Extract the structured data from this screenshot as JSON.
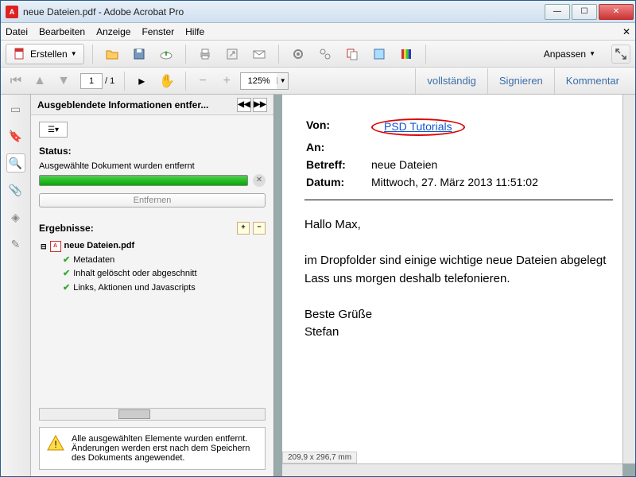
{
  "window": {
    "title": "neue Dateien.pdf - Adobe Acrobat Pro"
  },
  "menu": {
    "file": "Datei",
    "edit": "Bearbeiten",
    "view": "Anzeige",
    "window": "Fenster",
    "help": "Hilfe"
  },
  "toolbar": {
    "create": "Erstellen",
    "customize": "Anpassen"
  },
  "nav": {
    "page_current": "1",
    "page_total": "/ 1",
    "zoom": "125%"
  },
  "right_buttons": {
    "full": "vollständig",
    "sign": "Signieren",
    "comment": "Kommentar"
  },
  "panel": {
    "title": "Ausgeblendete Informationen entfer...",
    "status_label": "Status:",
    "status_text": "Ausgewählte Dokument wurden entfernt",
    "remove_btn": "Entfernen",
    "results_label": "Ergebnisse:",
    "file_name": "neue Dateien.pdf",
    "items": {
      "meta": "Metadaten",
      "deleted": "Inhalt gelöscht oder abgeschnitt",
      "links": "Links, Aktionen und Javascripts"
    },
    "notice": "Alle ausgewählten Elemente wurden entfernt. Änderungen werden erst nach dem Speichern des Dokuments angewendet."
  },
  "email": {
    "from_label": "Von:",
    "from_value": "PSD Tutorials",
    "to_label": "An:",
    "subject_label": "Betreff:",
    "subject_value": "neue Dateien",
    "date_label": "Datum:",
    "date_value": "Mittwoch, 27. März 2013 11:51:02",
    "greeting": "Hallo Max,",
    "para1": "im Dropfolder sind einige wichtige neue Dateien abgelegt",
    "para2": "Lass uns morgen deshalb telefonieren.",
    "closing": "Beste Grüße",
    "signature": "Stefan"
  },
  "statusbar": "209,9 x 296,7 mm"
}
